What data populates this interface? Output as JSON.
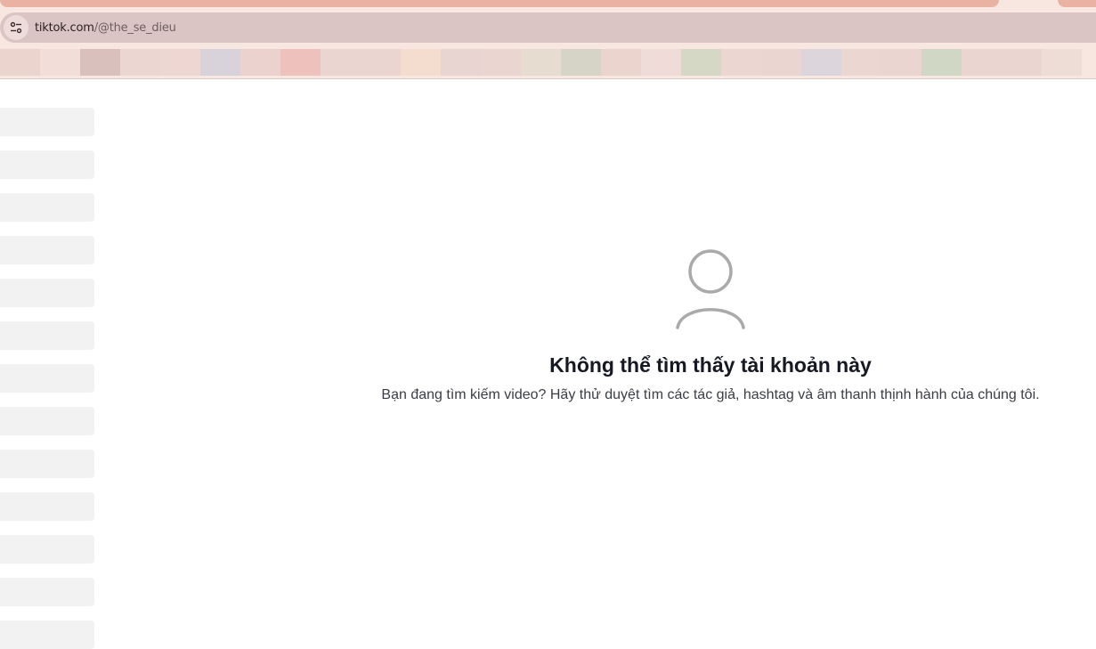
{
  "browser": {
    "url_host": "tiktok.com",
    "url_path": "/@the_se_dieu",
    "site_info_icon": "tune-icon",
    "bookmark_colors": [
      "#ecd4ce",
      "#f3ddd8",
      "#d9c0bc",
      "#ecd6d2",
      "#eed7d2",
      "#d8d3da",
      "#ecd2cf",
      "#efc1bc",
      "#ead5d1",
      "#ead5d1",
      "#f4dccf",
      "#e8d4d0",
      "#ead5d1",
      "#e6dccf",
      "#d6d4c6",
      "#ecd4ce",
      "#efdcd8",
      "#d4d8c4",
      "#ecd6d2",
      "#ead5d1",
      "#ddd5dc",
      "#ecd6d2",
      "#ead5d1",
      "#d0d8c5",
      "#ead5d1",
      "#ead5d1",
      "#eedcd7"
    ]
  },
  "empty_state": {
    "icon": "user-icon",
    "title": "Không thể tìm thấy tài khoản này",
    "description": "Bạn đang tìm kiếm video? Hãy thử duyệt tìm các tác giả, hashtag và âm thanh thịnh hành của chúng tôi."
  },
  "colors": {
    "skeleton": "#f2f2f2",
    "icon_gray": "#aaaaaa",
    "title_text": "#161823"
  }
}
